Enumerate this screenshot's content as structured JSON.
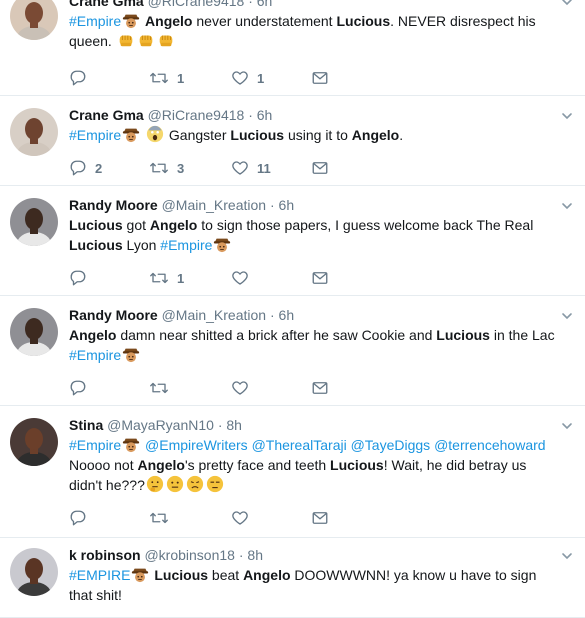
{
  "tweets": [
    {
      "name": "Crane Gma",
      "handle": "@RiCrane9418",
      "dot": "·",
      "time": "6h",
      "text_parts": [
        {
          "t": "#Empire",
          "k": "tag"
        },
        {
          "t": "",
          "k": "emoji",
          "e": "empire"
        },
        {
          "t": " "
        },
        {
          "t": "Angelo",
          "k": "bold"
        },
        {
          "t": " never understatement "
        },
        {
          "t": "Lucious",
          "k": "bold"
        },
        {
          "t": ". NEVER disrespect his queen. "
        },
        {
          "t": "",
          "k": "emoji",
          "e": "fist"
        },
        {
          "t": "",
          "k": "emoji",
          "e": "fist"
        },
        {
          "t": "",
          "k": "emoji",
          "e": "fist"
        }
      ],
      "reply_count": "",
      "retweet_count": "1",
      "like_count": "1"
    },
    {
      "name": "Crane Gma",
      "handle": "@RiCrane9418",
      "dot": "·",
      "time": "6h",
      "text_parts": [
        {
          "t": "#Empire",
          "k": "tag"
        },
        {
          "t": "",
          "k": "emoji",
          "e": "empire"
        },
        {
          "t": " "
        },
        {
          "t": "",
          "k": "emoji",
          "e": "scream"
        },
        {
          "t": " Gangster "
        },
        {
          "t": "Lucious",
          "k": "bold"
        },
        {
          "t": " using it to "
        },
        {
          "t": "Angelo",
          "k": "bold"
        },
        {
          "t": "."
        }
      ],
      "reply_count": "2",
      "retweet_count": "3",
      "like_count": "11"
    },
    {
      "name": "Randy Moore",
      "handle": "@Main_Kreation",
      "dot": "·",
      "time": "6h",
      "text_parts": [
        {
          "t": "Lucious",
          "k": "bold"
        },
        {
          "t": " got "
        },
        {
          "t": "Angelo",
          "k": "bold"
        },
        {
          "t": " to sign those papers, I guess welcome back The Real "
        },
        {
          "t": "Lucious",
          "k": "bold"
        },
        {
          "t": " Lyon "
        },
        {
          "t": "#Empire",
          "k": "tag"
        },
        {
          "t": "",
          "k": "emoji",
          "e": "empire"
        }
      ],
      "reply_count": "",
      "retweet_count": "1",
      "like_count": ""
    },
    {
      "name": "Randy Moore",
      "handle": "@Main_Kreation",
      "dot": "·",
      "time": "6h",
      "text_parts": [
        {
          "t": "Angelo",
          "k": "bold"
        },
        {
          "t": " damn near shitted a brick after he saw Cookie and "
        },
        {
          "t": "Lucious",
          "k": "bold"
        },
        {
          "t": " in the Lac "
        },
        {
          "t": "#Empire",
          "k": "tag"
        },
        {
          "t": "",
          "k": "emoji",
          "e": "empire"
        }
      ],
      "reply_count": "",
      "retweet_count": "",
      "like_count": ""
    },
    {
      "name": "Stina",
      "handle": "@MayaRyanN10",
      "dot": "·",
      "time": "8h",
      "text_parts": [
        {
          "t": "#Empire",
          "k": "tag"
        },
        {
          "t": "",
          "k": "emoji",
          "e": "empire"
        },
        {
          "t": " "
        },
        {
          "t": "@EmpireWriters",
          "k": "tag"
        },
        {
          "t": " "
        },
        {
          "t": "@TherealTaraji",
          "k": "tag"
        },
        {
          "t": " "
        },
        {
          "t": "@TayeDiggs",
          "k": "tag"
        },
        {
          "t": " "
        },
        {
          "t": "@terrencehoward",
          "k": "tag"
        },
        {
          "t": " Noooo not "
        },
        {
          "t": "Angelo",
          "k": "bold"
        },
        {
          "t": "'s pretty face and teeth "
        },
        {
          "t": "Lucious",
          "k": "bold"
        },
        {
          "t": "! Wait, he did betray us didn't he???"
        },
        {
          "t": "",
          "k": "emoji",
          "e": "think"
        },
        {
          "t": "",
          "k": "emoji",
          "e": "neutral"
        },
        {
          "t": "",
          "k": "emoji",
          "e": "sad"
        },
        {
          "t": "",
          "k": "emoji",
          "e": "unamused"
        }
      ],
      "reply_count": "",
      "retweet_count": "",
      "like_count": ""
    },
    {
      "name": "k robinson",
      "handle": "@krobinson18",
      "dot": "·",
      "time": "8h",
      "text_parts": [
        {
          "t": "#EMPIRE",
          "k": "tag"
        },
        {
          "t": "",
          "k": "emoji",
          "e": "empire"
        },
        {
          "t": " "
        },
        {
          "t": "Lucious",
          "k": "bold"
        },
        {
          "t": " beat "
        },
        {
          "t": "Angelo",
          "k": "bold"
        },
        {
          "t": " DOOWWWNN!   ya know u have to sign that shit!"
        }
      ],
      "reply_count": "",
      "retweet_count": "",
      "like_count": ""
    }
  ],
  "icons": {
    "reply": "reply-icon",
    "retweet": "retweet-icon",
    "like": "heart-icon",
    "dm": "envelope-icon",
    "caret": "chevron-down-icon"
  },
  "colors": {
    "link": "#1b95e0",
    "muted": "#657786",
    "text": "#14171a",
    "divider": "#e6ecf0"
  }
}
